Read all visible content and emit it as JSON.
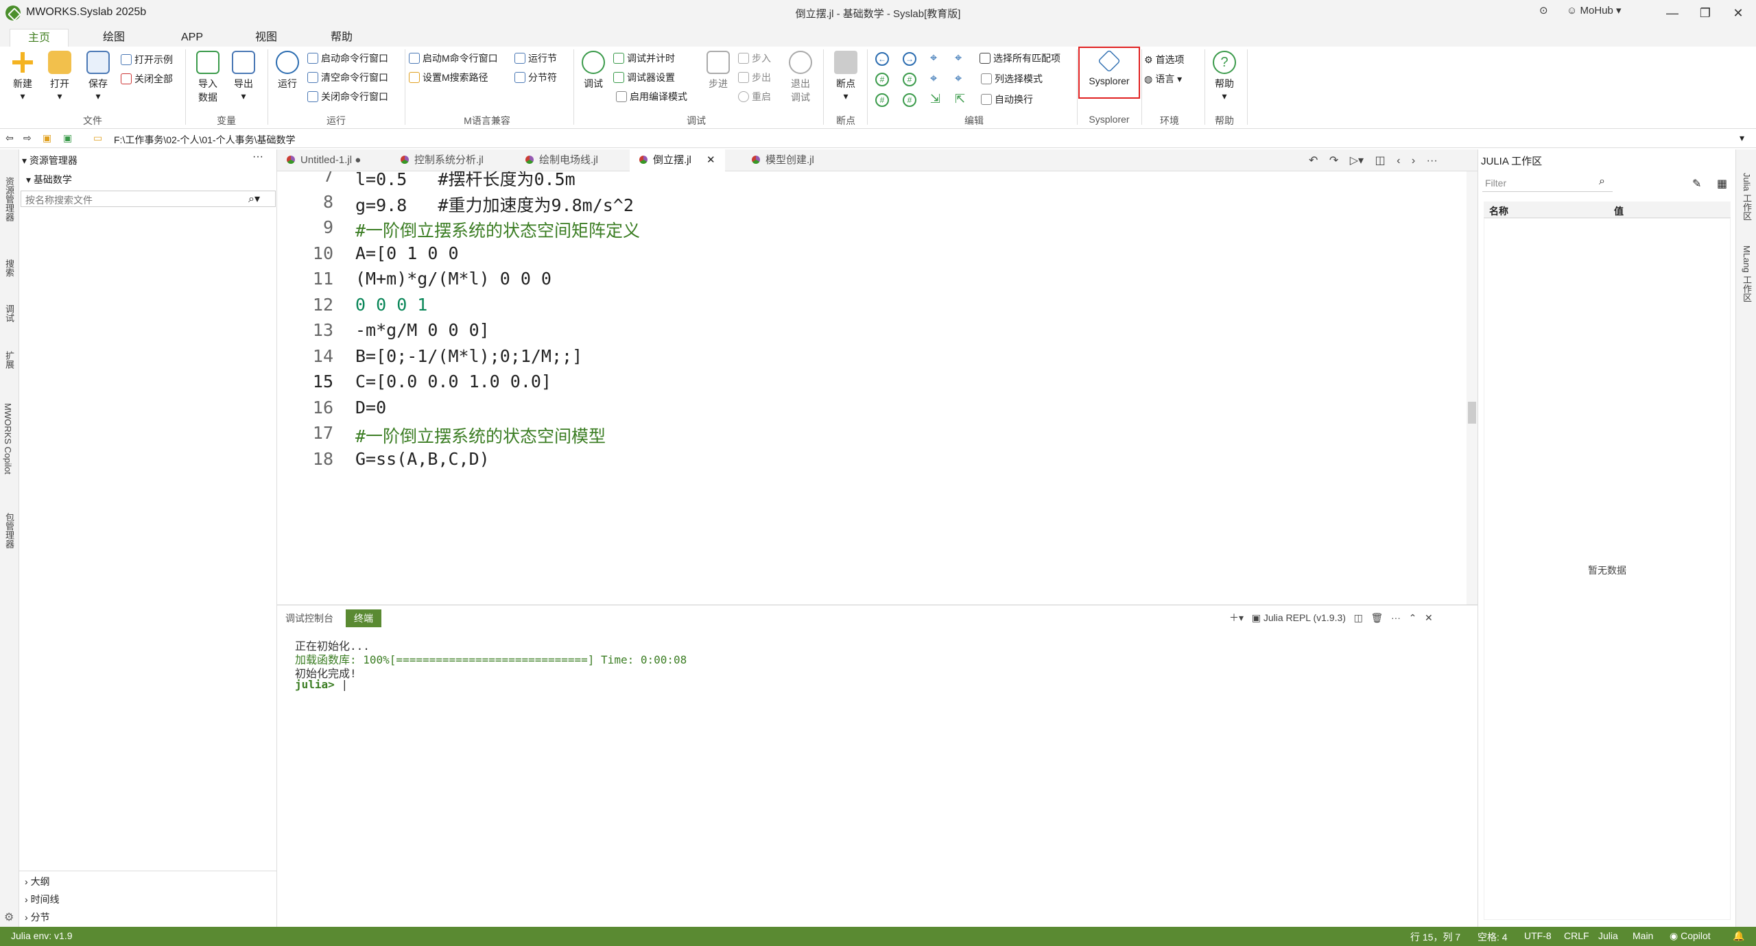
{
  "titlebar": {
    "app_name": "MWORKS.Syslab 2025b",
    "window_title": "倒立摆.jl - 基础数学 - Syslab[教育版]",
    "user": "MoHub"
  },
  "menu": [
    "主页",
    "绘图",
    "APP",
    "视图",
    "帮助"
  ],
  "search_placeholder": "搜索",
  "ribbon": {
    "file": {
      "new": "新建",
      "open": "打开",
      "save": "保存",
      "open_example": "打开示例",
      "close_all": "关闭全部",
      "group": "文件"
    },
    "vars": {
      "import1": "导入",
      "import2": "数据",
      "export": "导出",
      "group": "变量"
    },
    "run": {
      "run": "运行",
      "start_cmd": "启动命令行窗口",
      "clear_cmd": "清空命令行窗口",
      "close_cmd": "关闭命令行窗口",
      "group": "运行"
    },
    "mlang": {
      "start_m": "启动M命令行窗口",
      "set_m_path": "设置M搜索路径",
      "run_section": "运行节",
      "section_sep": "分节符",
      "group": "M语言兼容"
    },
    "debug": {
      "debug": "调试",
      "debug_timer": "调试并计时",
      "debugger_settings": "调试器设置",
      "compile_mode": "启用编译模式",
      "step": "步进",
      "step_in": "步入",
      "step_out": "步出",
      "restart": "重启",
      "exit1": "退出",
      "exit2": "调试",
      "group": "调试"
    },
    "bp": {
      "breakpoint": "断点",
      "group": "断点"
    },
    "edit": {
      "select_all_matches": "选择所有匹配项",
      "column_mode": "列选择模式",
      "word_wrap": "自动换行",
      "group": "编辑"
    },
    "sysplorer": {
      "label": "Sysplorer",
      "group": "Sysplorer"
    },
    "env": {
      "prefs": "首选项",
      "lang": "语言",
      "group": "环境"
    },
    "help": {
      "label": "帮助",
      "group": "帮助"
    }
  },
  "path": "F:\\工作事务\\02-个人\\01-个人事务\\基础数学",
  "explorer": {
    "title": "资源管理器",
    "folder": "基础数学",
    "search_placeholder": "按名称搜索文件",
    "sections": [
      "大纲",
      "时间线",
      "分节"
    ]
  },
  "activity": [
    "资源管理器",
    "搜索",
    "调试",
    "扩展",
    "MWORKS Copilot",
    "包管理器"
  ],
  "tabs": [
    {
      "label": "Untitled-1.jl",
      "modified": "●"
    },
    {
      "label": "控制系统分析.jl"
    },
    {
      "label": "绘制电场线.jl"
    },
    {
      "label": "倒立摆.jl",
      "close": "✕"
    },
    {
      "label": "模型创建.jl"
    }
  ],
  "code": [
    {
      "n": "7",
      "t": "l=0.5   #摆杆长度为0.5m"
    },
    {
      "n": "8",
      "t": "g=9.8   #重力加速度为9.8m/s^2"
    },
    {
      "n": "9",
      "t": "#一阶倒立摆系统的状态空间矩阵定义"
    },
    {
      "n": "10",
      "t": "A=[0 1 0 0"
    },
    {
      "n": "11",
      "t": "(M+m)*g/(M*l) 0 0 0"
    },
    {
      "n": "12",
      "t": "0 0 0 1"
    },
    {
      "n": "13",
      "t": "-m*g/M 0 0 0]"
    },
    {
      "n": "14",
      "t": "B=[0;-1/(M*l);0;1/M;;]"
    },
    {
      "n": "15",
      "t": "C=[0.0 0.0 1.0 0.0]"
    },
    {
      "n": "16",
      "t": "D=0"
    },
    {
      "n": "17",
      "t": "#一阶倒立摆系统的状态空间模型"
    },
    {
      "n": "18",
      "t": "G=ss(A,B,C,D)"
    }
  ],
  "terminal": {
    "tabs": [
      "调试控制台",
      "终端"
    ],
    "repl": "Julia REPL (v1.9.3)",
    "lines": [
      "正在初始化...",
      "加载函数库: 100%[=============================] Time: 0:00:08",
      "初始化完成!"
    ],
    "prompt": "julia>"
  },
  "workspace": {
    "title": "JULIA 工作区",
    "filter_placeholder": "Filter",
    "col_name": "名称",
    "col_value": "值",
    "empty": "暂无数据"
  },
  "rightbar": [
    "Julia 工作区",
    "MLang 工作区"
  ],
  "status": {
    "env": "Julia env: v1.9",
    "pos": "行 15，列 7",
    "spaces": "空格: 4",
    "enc": "UTF-8",
    "eol": "CRLF",
    "lang": "Julia",
    "branch": "Main",
    "copilot": "Copilot"
  },
  "colors": {
    "accent": "#5a8a32",
    "highlight_box": "#e02020"
  }
}
